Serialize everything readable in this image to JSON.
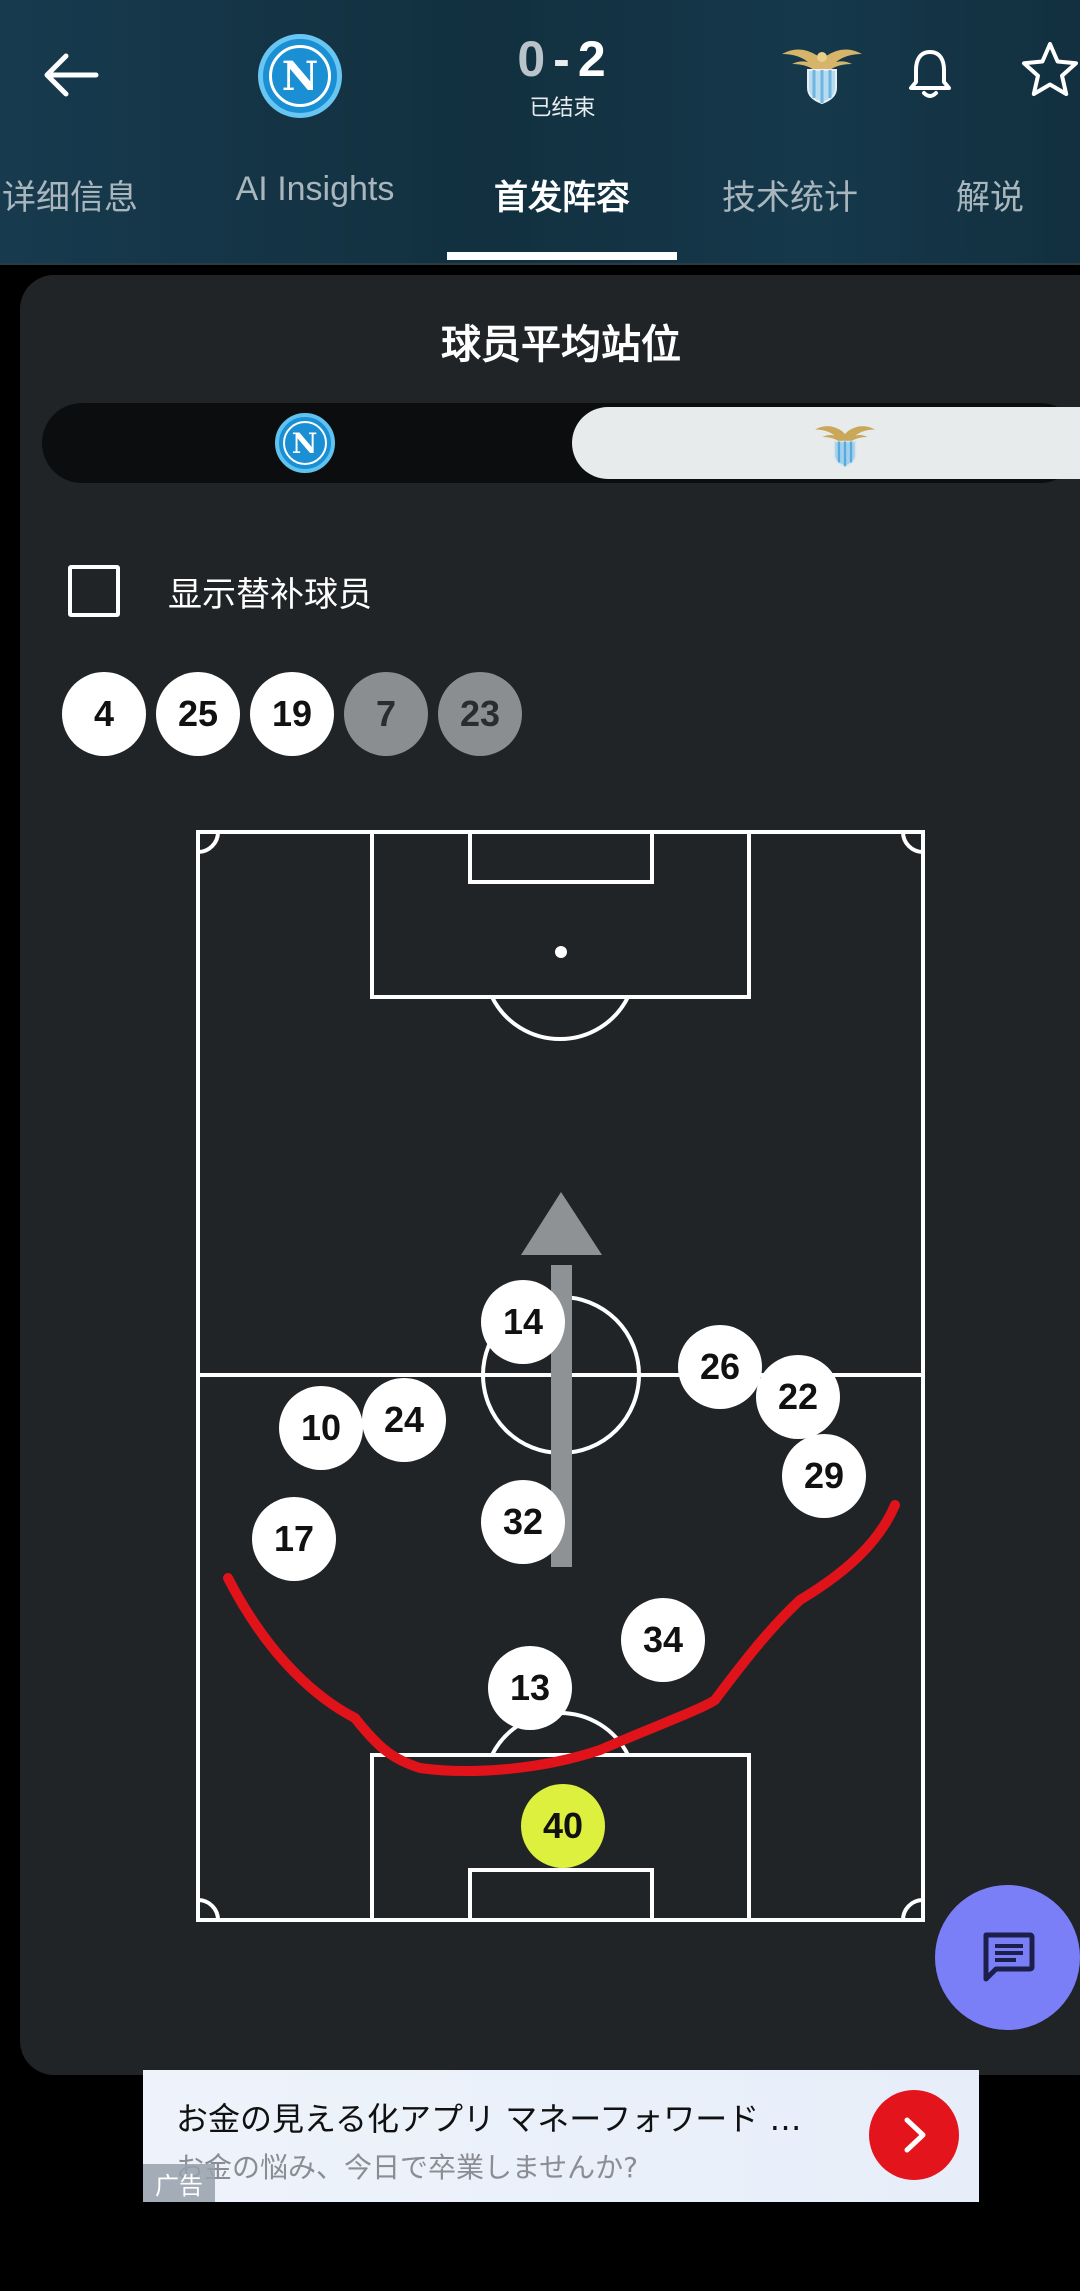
{
  "header": {
    "home_score": "0",
    "separator": "-",
    "away_score": "2",
    "status": "已结束",
    "home_team_logo_letter": "N"
  },
  "tabs": [
    {
      "label": "详细信息",
      "active": false
    },
    {
      "label": "AI Insights",
      "active": false
    },
    {
      "label": "首发阵容",
      "active": true
    },
    {
      "label": "技术统计",
      "active": false
    },
    {
      "label": "解说",
      "active": false
    }
  ],
  "card": {
    "title": "球员平均站位",
    "toggle": {
      "selected": "away"
    },
    "show_subs": {
      "label": "显示替补球员",
      "checked": false
    }
  },
  "absent_players": [
    {
      "number": "4",
      "style": "white"
    },
    {
      "number": "25",
      "style": "white"
    },
    {
      "number": "19",
      "style": "white"
    },
    {
      "number": "7",
      "style": "grey"
    },
    {
      "number": "23",
      "style": "grey"
    }
  ],
  "players": [
    {
      "number": "14"
    },
    {
      "number": "26"
    },
    {
      "number": "22"
    },
    {
      "number": "10"
    },
    {
      "number": "24"
    },
    {
      "number": "29"
    },
    {
      "number": "17"
    },
    {
      "number": "32"
    },
    {
      "number": "34"
    },
    {
      "number": "13"
    },
    {
      "number": "40",
      "goalkeeper": true
    }
  ],
  "ad": {
    "title": "お金の見える化アプリ マネーフォワード …",
    "subtitle": "お金の悩み、今日で卒業しませんか?",
    "tag": "广告"
  },
  "colors": {
    "header_bg": "#173a4e",
    "card_bg": "#202427",
    "goalkeeper": "#dcf03d",
    "annotation_stroke": "#e0121a",
    "fab": "#7a7ff8",
    "ad_cta": "#e3141b"
  }
}
